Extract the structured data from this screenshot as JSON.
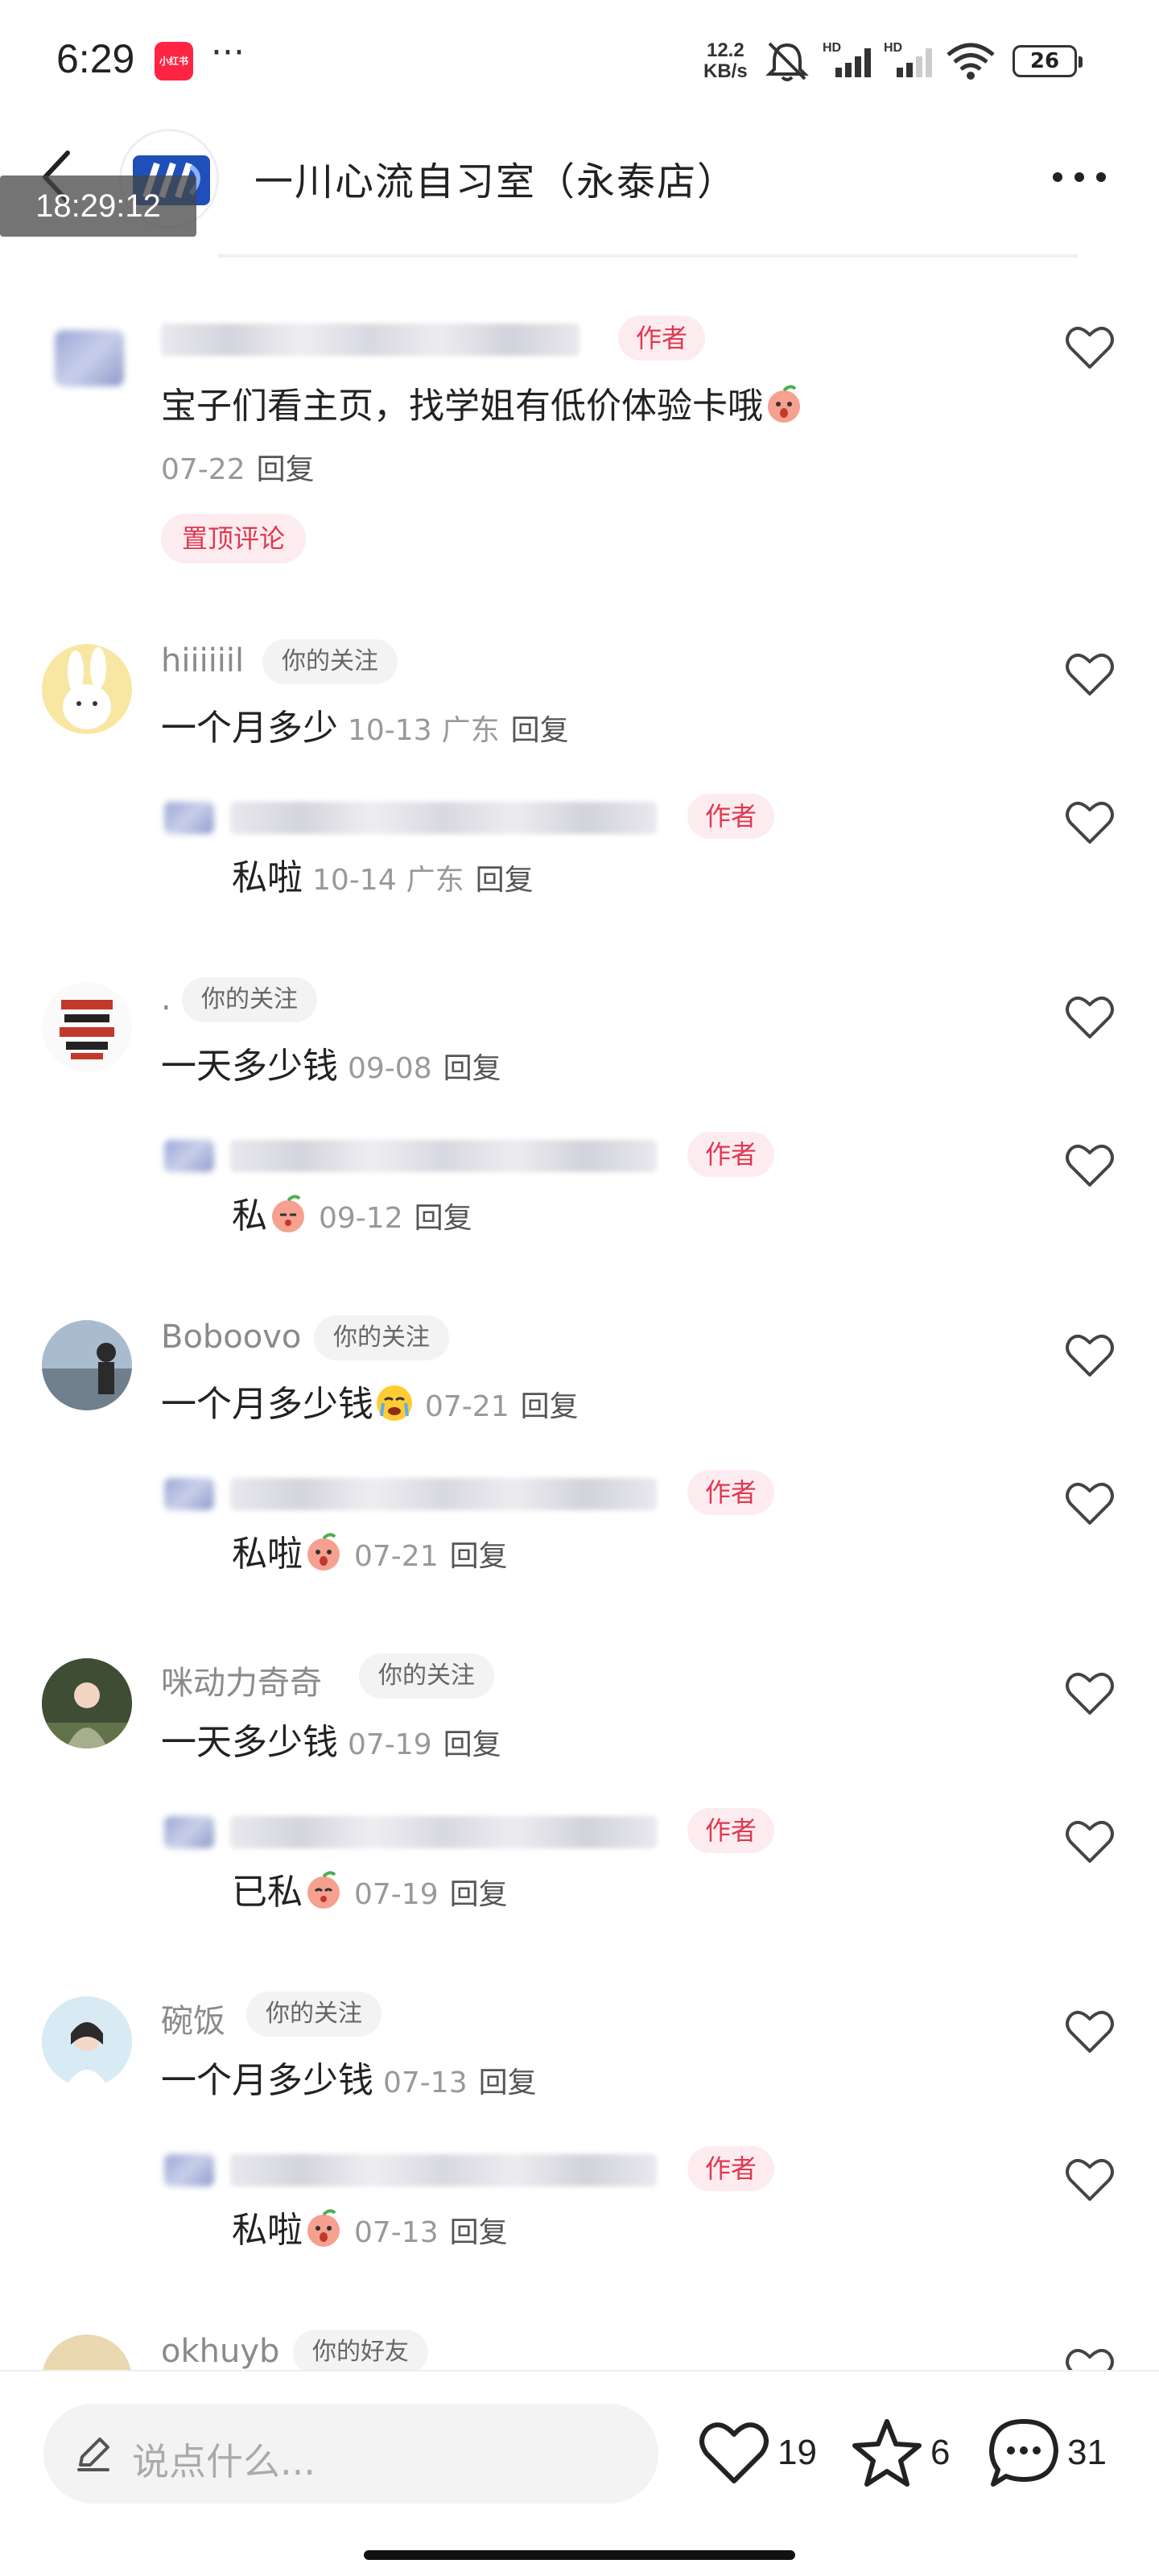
{
  "status_bar": {
    "time": "6:29",
    "app_badge": "小红书",
    "more": "···",
    "net_speed_value": "12.2",
    "net_speed_unit": "KB/s",
    "battery": "26"
  },
  "header": {
    "title": "一川心流自习室（永泰店）",
    "timestamp_overlay": "18:29:12"
  },
  "labels": {
    "author": "作者",
    "follow": "你的关注",
    "friend": "你的好友",
    "reply": "回复",
    "pinned": "置顶评论"
  },
  "pinned_comment": {
    "text": "宝子们看主页，找学姐有低价体验卡哦",
    "date": "07-22"
  },
  "comments": [
    {
      "username": "hiiiiiil",
      "text": "一个月多少",
      "date": "10-13",
      "location": "广东",
      "reply": {
        "text": "私啦",
        "date": "10-14",
        "location": "广东"
      }
    },
    {
      "username": ".",
      "text": "一天多少钱",
      "date": "09-08",
      "reply": {
        "text": "私",
        "date": "09-12"
      }
    },
    {
      "username": "Boboovo",
      "text": "一个月多少钱",
      "date": "07-21",
      "reply": {
        "text": "私啦",
        "date": "07-21"
      }
    },
    {
      "username": "咪动力奇奇",
      "text": "一天多少钱",
      "date": "07-19",
      "reply": {
        "text": "已私",
        "date": "07-19"
      }
    },
    {
      "username": "碗饭",
      "text": "一个月多少钱",
      "date": "07-13",
      "reply": {
        "text": "私啦",
        "date": "07-13"
      }
    },
    {
      "username": "okhuyb"
    }
  ],
  "bottom_bar": {
    "input_placeholder": "说点什么...",
    "likes": "19",
    "favorites": "6",
    "comments": "31"
  },
  "colors": {
    "accent_red": "#e0384f",
    "tag_pink_bg": "#fdecef",
    "muted_text": "#999999"
  }
}
